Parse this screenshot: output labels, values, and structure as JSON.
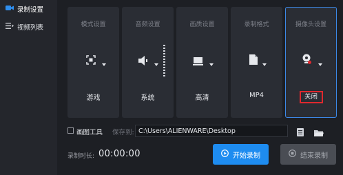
{
  "sidebar": {
    "items": [
      {
        "label": "录制设置",
        "icon": "camera-icon",
        "active": true
      },
      {
        "label": "视频列表",
        "icon": "list-icon",
        "active": false
      }
    ]
  },
  "cards": [
    {
      "title": "模式设置",
      "value": "游戏",
      "icon": "game-mode-icon"
    },
    {
      "title": "音频设置",
      "value": "系统",
      "icon": "speaker-icon"
    },
    {
      "title": "画质设置",
      "value": "高清",
      "icon": "monitor-icon"
    },
    {
      "title": "录制格式",
      "value": "MP4",
      "icon": "file-icon"
    },
    {
      "title": "摄像头设置",
      "value": "关闭",
      "icon": "webcam-icon"
    }
  ],
  "toolbar": {
    "draw_tool_label": "画图工具",
    "draw_tool_checked": false,
    "save_to_label": "保存到:",
    "save_path": "C:\\Users\\ALIENWARE\\Desktop"
  },
  "footer": {
    "duration_label": "录制时长:",
    "duration_value": "00:00:00",
    "start_label": "开始录制",
    "stop_label": "结束录制"
  },
  "colors": {
    "accent": "#1e8cf0",
    "highlight_border": "#e0282e",
    "active_card_border": "#3c88e6"
  }
}
